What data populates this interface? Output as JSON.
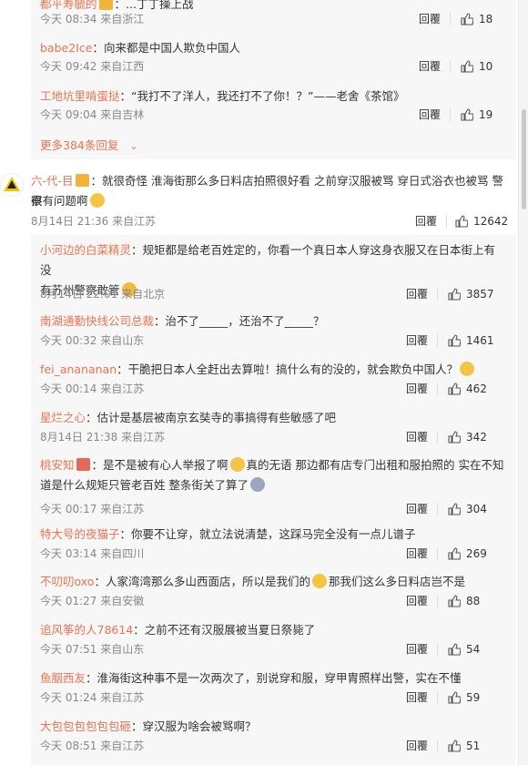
{
  "top_replies": [
    {
      "user": "都平寿毓的",
      "text": "...丁丁操上战",
      "time": "今天 08:34 来自浙江",
      "reply": "回覆",
      "likes": "18"
    },
    {
      "user": "babe2Ice",
      "text": "向来都是中国人欺负中国人",
      "time": "今天 09:42 来自江西",
      "reply": "回覆",
      "likes": "10"
    },
    {
      "user": "工地坑里啃蛋挞",
      "text": "“我打不了洋人，我还打不了你！？”——老舍《茶馆》",
      "time": "今天 09:04 来自吉林",
      "reply": "回覆",
      "likes": "19"
    }
  ],
  "more_replies": "更多384条回复",
  "main_comment": {
    "user": "六-代-目",
    "text1": "就很奇怪 淮海街那么多日料店拍照很好看 之前穿汉服被骂 穿日式浴衣也被骂 警察",
    "text2": "很有问题啊",
    "time": "8月14日 21:36 来自江苏",
    "reply": "回覆",
    "likes": "12642",
    "avatar_label": "avatar"
  },
  "sub_replies": [
    {
      "user": "小河边的白菜精灵",
      "text": "规矩都是给老百姓定的，你看一个真日本人穿这身衣服又在日本街上有没",
      "text2": "有苏州警察敢管",
      "time": "8月14日 22:01 来自北京",
      "reply": "回覆",
      "likes": "3857"
    },
    {
      "user": "南湖通勤快线公司总裁",
      "text": "治不了_____，还治不了_____？",
      "time": "今天 00:32 来自山东",
      "reply": "回覆",
      "likes": "1461"
    },
    {
      "user": "fei_anananan",
      "text": "干脆把日本人全赶出去算啦！搞什么有的没的，就会欺负中国人？",
      "time": "今天 00:14 来自江苏",
      "reply": "回覆",
      "likes": "462"
    },
    {
      "user": "星烂之心",
      "text": "估计是基层被南京玄奘寺的事搞得有些敏感了吧",
      "time": "8月14日 21:38 来自江苏",
      "reply": "回覆",
      "likes": "342"
    },
    {
      "user": "桃安知",
      "text": "是不是被有心人举报了啊",
      "text_b": "真的无语 那边都有店专门出租和服拍照的 实在不知",
      "text2": "道是什么规矩只管老百姓 整条街关了算了",
      "time": "今天 00:17 来自江苏",
      "reply": "回覆",
      "likes": "304"
    },
    {
      "user": "特大号的夜猫子",
      "text": "你要不让穿，就立法说清楚，这踩马完全没有一点儿谱子",
      "time": "今天 03:14 来自四川",
      "reply": "回覆",
      "likes": "269"
    },
    {
      "user": "不叨叨oxo",
      "text": "人家湾湾那么多山西面店，所以是我们的",
      "text_b": "那我们这么多日料店岂不是",
      "time": "今天 01:27 来自安徽",
      "reply": "回覆",
      "likes": "88"
    },
    {
      "user": "追风筝的人78614",
      "text": "之前不还有汉服展被当夏日祭毙了",
      "time": "今天 07:51 来自山东",
      "reply": "回覆",
      "likes": "54"
    },
    {
      "user": "鱼胭西友",
      "text": "淮海街这种事不是一次两次了，别说穿和服，穿甲胄照样出警，实在不懂",
      "time": "今天 01:24 来自江苏",
      "reply": "回覆",
      "likes": "59"
    },
    {
      "user": "大包包包包包包砸",
      "text": "穿汉服为啥会被骂啊？",
      "time": "今天 08:51 来自江苏",
      "reply": "回覆",
      "likes": "51"
    }
  ]
}
